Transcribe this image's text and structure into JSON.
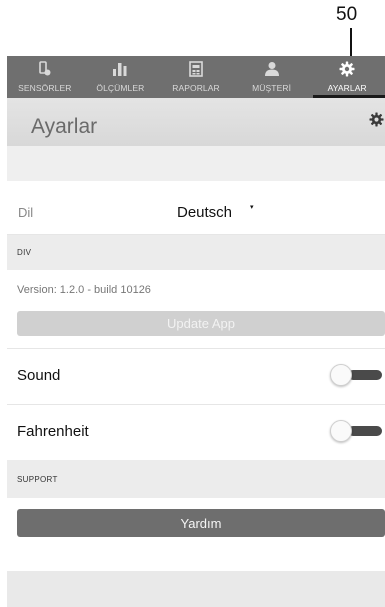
{
  "callout": {
    "number": "50"
  },
  "tabs": [
    {
      "label": "SENSÖRLER",
      "icon": "sensor-icon",
      "active": false
    },
    {
      "label": "ÖLÇÜMLER",
      "icon": "bar-chart-icon",
      "active": false
    },
    {
      "label": "RAPORLAR",
      "icon": "report-icon",
      "active": false
    },
    {
      "label": "MÜŞTERİ",
      "icon": "customer-icon",
      "active": false
    },
    {
      "label": "AYARLAR",
      "icon": "settings-icon",
      "active": true
    }
  ],
  "header": {
    "title": "Ayarlar",
    "icon": "gear-icon"
  },
  "language": {
    "label": "Dil",
    "value": "Deutsch",
    "caret": "▾"
  },
  "sections": {
    "div": "DIV",
    "support": "SUPPORT"
  },
  "about": {
    "version": "Version: 1.2.0 - build 10126",
    "update_label": "Update App"
  },
  "toggles": [
    {
      "label": "Sound",
      "on": false
    },
    {
      "label": "Fahrenheit",
      "on": false
    }
  ],
  "support": {
    "help_label": "Yardım"
  },
  "colors": {
    "tabbar": "#6f6f6f",
    "primary_button": "#6e6e6e",
    "disabled_button": "#d0d0d0",
    "toggle_track": "#4a4a4a"
  }
}
